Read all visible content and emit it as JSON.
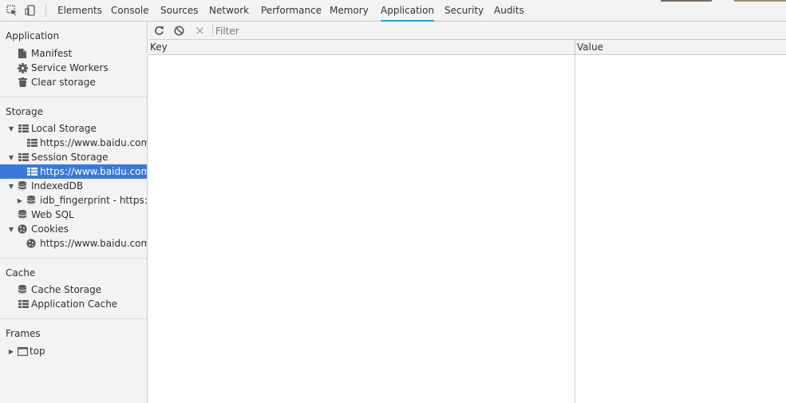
{
  "tabs": [
    {
      "label": "Elements",
      "active": false
    },
    {
      "label": "Console",
      "active": false
    },
    {
      "label": "Sources",
      "active": false
    },
    {
      "label": "Network",
      "active": false
    },
    {
      "label": "Performance",
      "active": false
    },
    {
      "label": "Memory",
      "active": false
    },
    {
      "label": "Application",
      "active": true
    },
    {
      "label": "Security",
      "active": false
    },
    {
      "label": "Audits",
      "active": false
    }
  ],
  "sidebar": {
    "application": {
      "title": "Application",
      "items": [
        {
          "label": "Manifest",
          "icon": "document-icon"
        },
        {
          "label": "Service Workers",
          "icon": "gear-icon"
        },
        {
          "label": "Clear storage",
          "icon": "trash-icon"
        }
      ]
    },
    "storage": {
      "title": "Storage",
      "local_storage": {
        "label": "Local Storage",
        "expanded": true,
        "children": [
          "https://www.baidu.com"
        ]
      },
      "session_storage": {
        "label": "Session Storage",
        "expanded": true,
        "children": [
          "https://www.baidu.com"
        ],
        "selected_child": 0
      },
      "indexeddb": {
        "label": "IndexedDB",
        "expanded": true,
        "children": [
          "idb_fingerprint - https://w"
        ]
      },
      "web_sql": {
        "label": "Web SQL"
      },
      "cookies": {
        "label": "Cookies",
        "expanded": true,
        "children": [
          "https://www.baidu.com"
        ]
      }
    },
    "cache": {
      "title": "Cache",
      "items": [
        {
          "label": "Cache Storage",
          "icon": "database-icon"
        },
        {
          "label": "Application Cache",
          "icon": "grid-icon"
        }
      ]
    },
    "frames": {
      "title": "Frames",
      "top": {
        "label": "top",
        "expanded": false
      }
    }
  },
  "toolbar": {
    "filter_placeholder": "Filter"
  },
  "grid": {
    "columns": [
      "Key",
      "Value"
    ],
    "rows": []
  },
  "colors": {
    "selection": "#3879d9",
    "active_tab_underline": "#03a9f4",
    "panel_background": "#f3f3f3",
    "border": "#cccccc"
  }
}
